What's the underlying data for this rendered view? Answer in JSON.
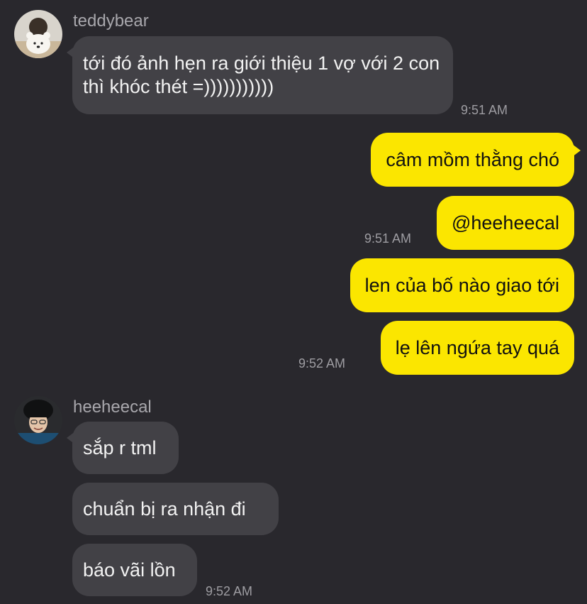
{
  "chat": {
    "groups": [
      {
        "sender": "teddybear",
        "avatar_icon": "teddy-bear-avatar",
        "messages": [
          {
            "text": "tới đó ảnh hẹn ra giới thiệu 1 vợ với 2 con thì khóc thét =)))))))))))"
          }
        ],
        "time": "9:51 AM"
      },
      {
        "sender": "me",
        "messages": [
          {
            "text": "câm mồm thằng chó"
          },
          {
            "text": "@heeheecal",
            "time": "9:51 AM"
          },
          {
            "text": "len của bố nào giao tới"
          },
          {
            "text": "lẹ lên ngứa tay quá",
            "time": "9:52 AM"
          }
        ]
      },
      {
        "sender": "heeheecal",
        "avatar_icon": "person-photo-avatar",
        "messages": [
          {
            "text": "sắp r tml"
          },
          {
            "text": "chuẩn bị ra nhận đi"
          },
          {
            "text": "báo vãi lồn"
          }
        ],
        "time": "9:52 AM"
      }
    ]
  },
  "colors": {
    "background": "#29282d",
    "incoming_bubble": "#424146",
    "outgoing_bubble": "#fbe600",
    "meta_text": "#a8a7ac"
  }
}
